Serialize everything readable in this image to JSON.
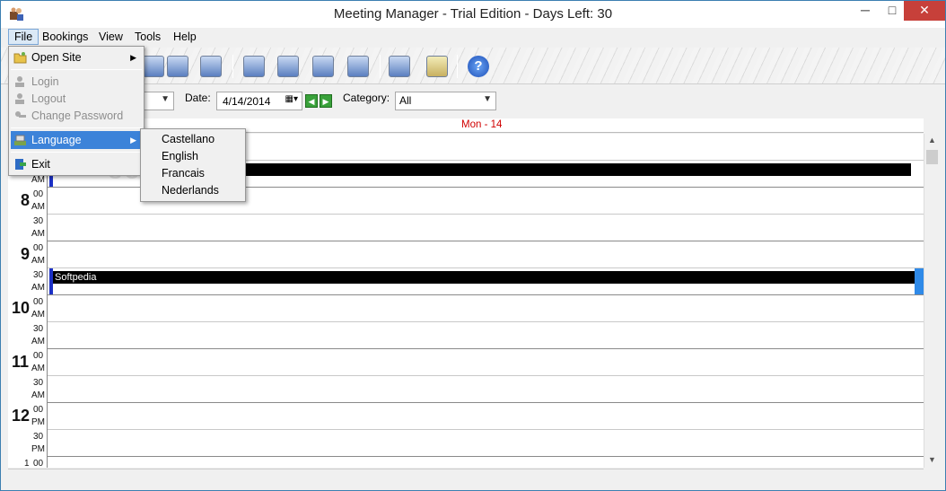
{
  "window": {
    "title": "Meeting Manager - Trial Edition - Days Left:  30",
    "minimize": "─",
    "maximize": "□",
    "close": "✕"
  },
  "menu": {
    "file": "File",
    "bookings": "Bookings",
    "view": "View",
    "tools": "Tools",
    "help": "Help"
  },
  "file_menu": {
    "open_site": "Open Site",
    "login": "Login",
    "logout": "Logout",
    "change_password": "Change Password",
    "language": "Language",
    "exit": "Exit"
  },
  "language_menu": {
    "items": [
      "Castellano",
      "English",
      "Francais",
      "Nederlands"
    ]
  },
  "filters": {
    "date_label": "Date:",
    "date_value": "4/14/2014",
    "category_label": "Category:",
    "category_value": "All"
  },
  "day_header": "Mon - 14",
  "times": {
    "h7_00": "00",
    "am": "AM",
    "pm": "PM",
    "h8": "8",
    "h9": "9",
    "h10": "10",
    "h11": "11",
    "h12": "12",
    "h1": "1",
    "m00": "00",
    "m30": "30"
  },
  "bookings": [
    {
      "label": ""
    },
    {
      "label": "Softpedia"
    }
  ],
  "watermark": "SOFTPEDIA",
  "toolbar": {
    "help": "?"
  }
}
